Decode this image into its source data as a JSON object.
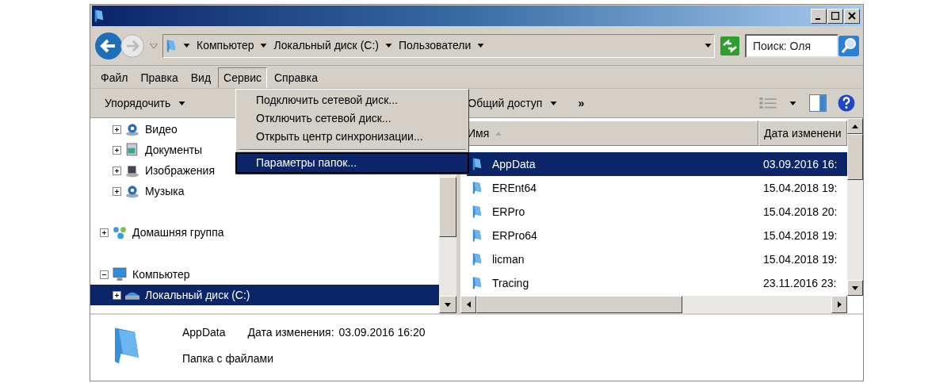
{
  "address_bar": {
    "breadcrumbs": [
      "Компьютер",
      "Локальный диск (C:)",
      "Пользователи"
    ],
    "search": {
      "placeholder": "Поиск: Оля"
    }
  },
  "menu_bar": [
    {
      "label": "Файл",
      "selected": false
    },
    {
      "label": "Правка",
      "selected": false
    },
    {
      "label": "Вид",
      "selected": false
    },
    {
      "label": "Сервис",
      "selected": true
    },
    {
      "label": "Справка",
      "selected": false
    }
  ],
  "toolbar": {
    "buttons": [
      "Упорядочить",
      "Общий доступ"
    ],
    "more": "»"
  },
  "open_menu": [
    {
      "kind": "item",
      "label": "Подключить сетевой диск...",
      "selected": false
    },
    {
      "kind": "item",
      "label": "Отключить сетевой диск...",
      "selected": false
    },
    {
      "kind": "item",
      "label": "Открыть центр синхронизации...",
      "selected": false
    },
    {
      "kind": "separator"
    },
    {
      "kind": "item",
      "label": "Параметры папок...",
      "selected": true
    }
  ],
  "tree": {
    "scrolled_children": [
      {
        "label": "Видео",
        "kind": "video",
        "expanded": false
      },
      {
        "label": "Документы",
        "kind": "documents",
        "expanded": false
      },
      {
        "label": "Изображения",
        "kind": "images",
        "expanded": false
      },
      {
        "label": "Музыка",
        "kind": "music",
        "expanded": false
      }
    ],
    "items": [
      {
        "label": "Домашняя группа",
        "kind": "homegroup",
        "expanded": false,
        "selected": false
      },
      {
        "label": "Компьютер",
        "kind": "computer",
        "expanded": true,
        "selected": false,
        "children": [
          {
            "label": "Локальный диск (C:)",
            "kind": "drive",
            "expanded": false,
            "selected": true
          }
        ]
      }
    ]
  },
  "file_list": {
    "columns": [
      {
        "label": "Имя",
        "sorted": true
      },
      {
        "label": "Дата изменени",
        "sorted": false
      }
    ],
    "rows": [
      {
        "name": "AppData",
        "date": "03.09.2016 16:",
        "selected": true
      },
      {
        "name": "EREnt64",
        "date": "15.04.2018 19:",
        "selected": false
      },
      {
        "name": "ERPro",
        "date": "15.04.2018 20:",
        "selected": false
      },
      {
        "name": "ERPro64",
        "date": "15.04.2018 19:",
        "selected": false
      },
      {
        "name": "licman",
        "date": "15.04.2018 19:",
        "selected": false
      },
      {
        "name": "Tracing",
        "date": "23.11.2016 23:",
        "selected": false
      }
    ]
  },
  "details": {
    "name": "AppData",
    "date_label": "Дата изменения:",
    "date_value": "03.09.2016 16:20",
    "type": "Папка с файлами"
  }
}
